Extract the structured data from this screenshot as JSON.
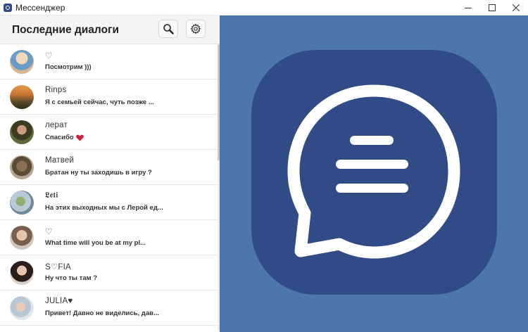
{
  "window": {
    "title": "Мессенджер"
  },
  "header": {
    "title": "Последние диалоги"
  },
  "colors": {
    "accent": "#4c77aa",
    "logo_bg": "#314b87",
    "heart": "#d0213c"
  },
  "icons": {
    "search": "magnifier-icon",
    "settings": "gear-icon"
  },
  "dialogs": [
    {
      "name": "♡",
      "preview": "Посмотрим )))"
    },
    {
      "name": "Rinps",
      "preview": "Я с семьей сейчас, чуть позже ..."
    },
    {
      "name": "лерат",
      "preview": "Спасибо"
    },
    {
      "name": "Матвей",
      "preview": "Братан ну ты заходишь в игру ?"
    },
    {
      "name": "𝕷𝖊𝖙𝖎",
      "preview": "На этих выходных мы с Лерой ед..."
    },
    {
      "name": "♡",
      "preview": "What time will you be at my pl..."
    },
    {
      "name": "S♡FIA",
      "preview": "Ну что ты там ?"
    },
    {
      "name": "JULIA♥",
      "preview": "Привет! Давно не виделись, дав..."
    }
  ]
}
